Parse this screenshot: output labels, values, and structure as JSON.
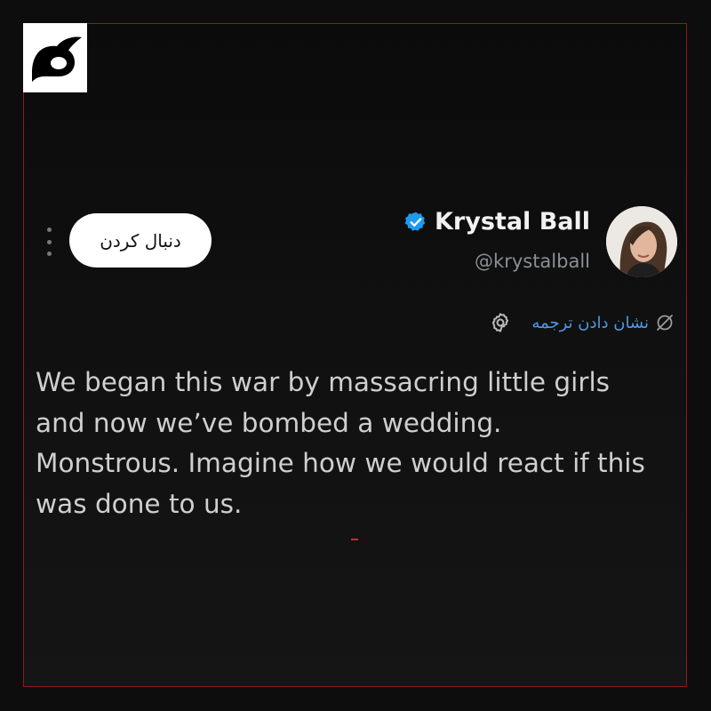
{
  "tweet": {
    "author": {
      "display_name": "Krystal Ball",
      "handle": "@krystalball",
      "verified": true,
      "avatar_icon": "profile-photo"
    },
    "follow_button_label": "دنبال کردن",
    "translate_label": "نشان دادن ترجمه",
    "text": "We began this war by massacring little girls\nand now we’ve bombed a wedding.\nMonstrous. Imagine how we would react if this\nwas done to us."
  },
  "icons": {
    "logo": "channel-logo",
    "more": "more-options-icon",
    "verified": "verified-badge-icon",
    "translate": "translate-icon",
    "settings": "gear-icon"
  },
  "colors": {
    "background": "#0d0d0d",
    "frame_border": "#8a1d1d",
    "text": "#cfcfcf",
    "handle": "#8a8f95",
    "link": "#4a9be8",
    "verified": "#1d9bf0"
  }
}
